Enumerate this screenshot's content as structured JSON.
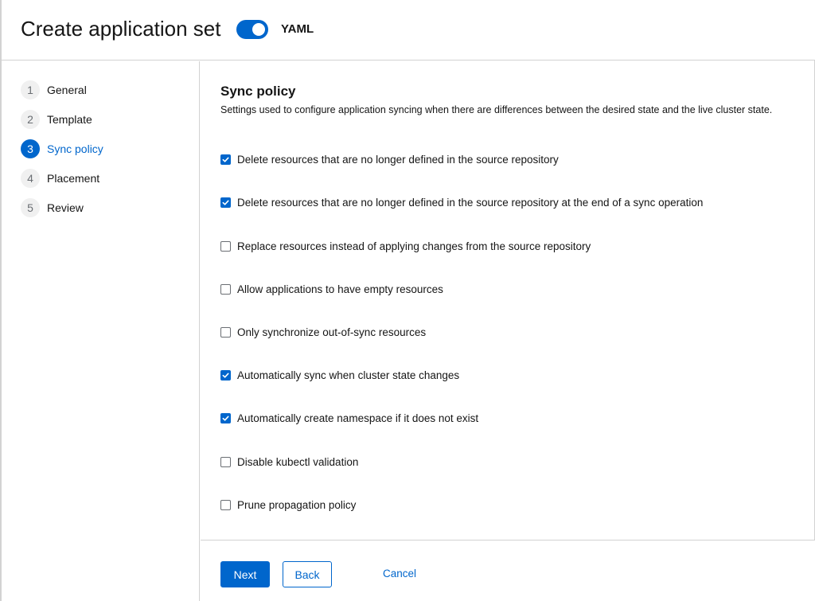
{
  "header": {
    "title": "Create application set",
    "yaml_toggle": {
      "label": "YAML",
      "on": true
    }
  },
  "nav": {
    "items": [
      {
        "number": "1",
        "label": "General",
        "active": false
      },
      {
        "number": "2",
        "label": "Template",
        "active": false
      },
      {
        "number": "3",
        "label": "Sync policy",
        "active": true
      },
      {
        "number": "4",
        "label": "Placement",
        "active": false
      },
      {
        "number": "5",
        "label": "Review",
        "active": false
      }
    ]
  },
  "main": {
    "title": "Sync policy",
    "description": "Settings used to configure application syncing when there are differences between the desired state and the live cluster state.",
    "options": [
      {
        "label": "Delete resources that are no longer defined in the source repository",
        "checked": true
      },
      {
        "label": "Delete resources that are no longer defined in the source repository at the end of a sync operation",
        "checked": true
      },
      {
        "label": "Replace resources instead of applying changes from the source repository",
        "checked": false
      },
      {
        "label": "Allow applications to have empty resources",
        "checked": false
      },
      {
        "label": "Only synchronize out-of-sync resources",
        "checked": false
      },
      {
        "label": "Automatically sync when cluster state changes",
        "checked": true
      },
      {
        "label": "Automatically create namespace if it does not exist",
        "checked": true
      },
      {
        "label": "Disable kubectl validation",
        "checked": false
      },
      {
        "label": "Prune propagation policy",
        "checked": false
      }
    ]
  },
  "footer": {
    "next_label": "Next",
    "back_label": "Back",
    "cancel_label": "Cancel"
  },
  "colors": {
    "accent": "#0066cc",
    "border": "#d2d2d2",
    "text": "#151515"
  }
}
